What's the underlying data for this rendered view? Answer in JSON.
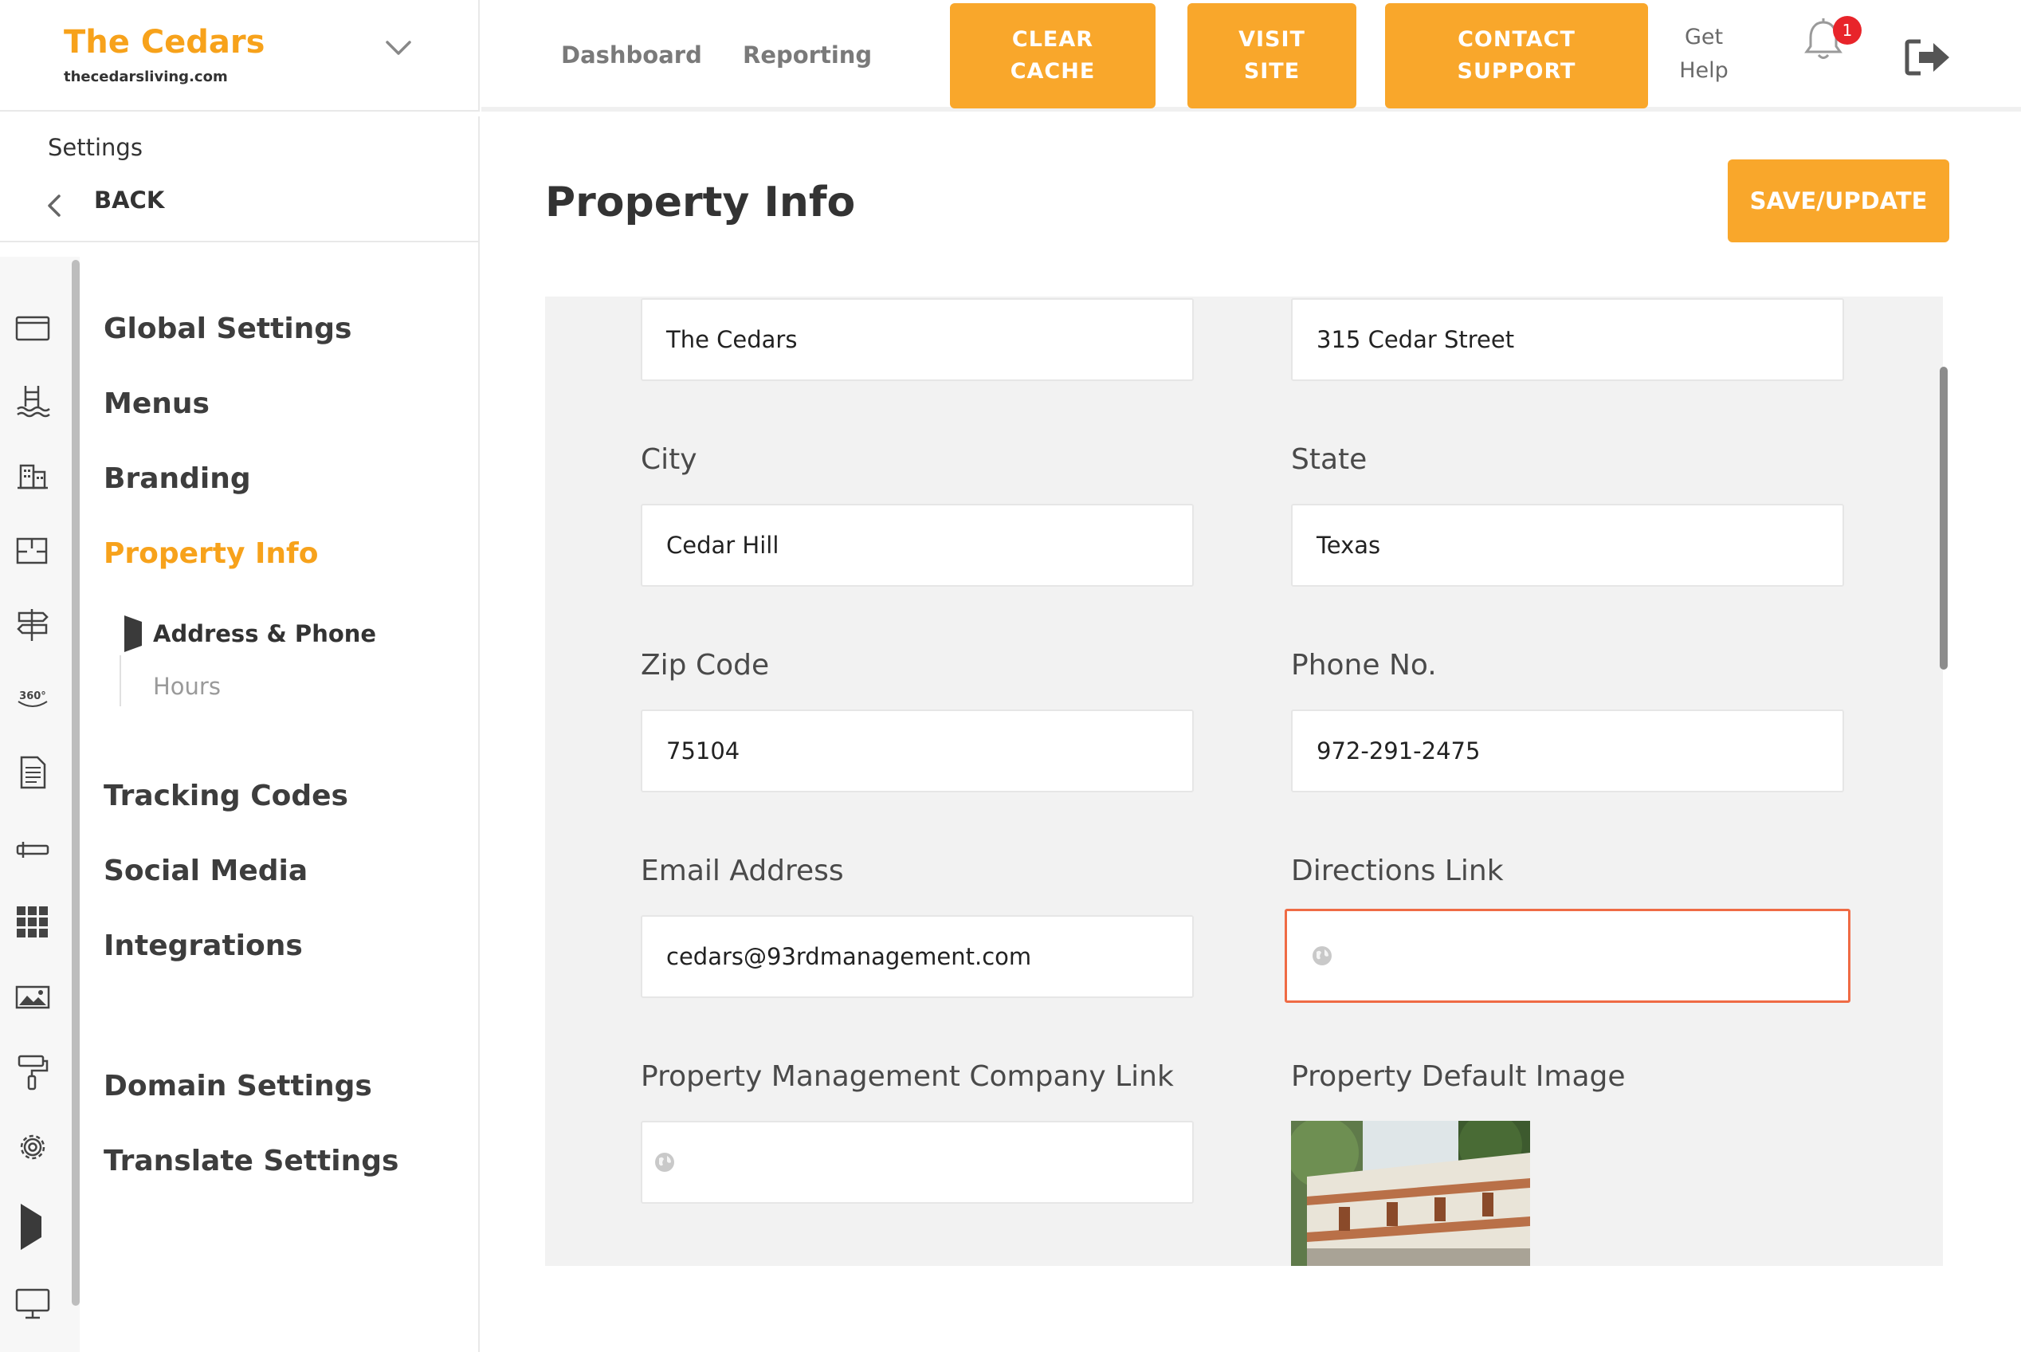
{
  "brand": {
    "name": "The Cedars",
    "domain": "thecedarsliving.com"
  },
  "topnav": {
    "dashboard": "Dashboard",
    "reporting": "Reporting",
    "clear_cache": [
      "CLEAR",
      "CACHE"
    ],
    "visit_site": [
      "VISIT",
      "SITE"
    ],
    "contact_support": [
      "CONTACT",
      "SUPPORT"
    ],
    "get_help": [
      "Get",
      "Help"
    ],
    "notification_count": "1"
  },
  "colors": {
    "accent": "#f9a72b",
    "active_text": "#f7a21b",
    "badge": "#e8242a",
    "focus_border": "#ef6b45"
  },
  "sidebar": {
    "header": "Settings",
    "back": "BACK",
    "items": {
      "global": "Global Settings",
      "menus": "Menus",
      "branding": "Branding",
      "property": "Property Info",
      "tracking": "Tracking Codes",
      "social": "Social Media",
      "integrations": "Integrations",
      "domain": "Domain Settings",
      "translate": "Translate Settings"
    },
    "subitems": {
      "address": "Address & Phone",
      "hours": "Hours"
    },
    "rail_icons": [
      "browser-window-icon",
      "pool-icon",
      "buildings-icon",
      "floorplan-icon",
      "signpost-icon",
      "360-view-icon",
      "document-icon",
      "key-icon",
      "grid-apps-icon",
      "image-icon",
      "paint-roller-icon",
      "gear-icon",
      "play-marker-icon",
      "monitor-icon"
    ]
  },
  "main": {
    "title": "Property Info",
    "save": "SAVE/UPDATE",
    "fields": {
      "property_name": "The Cedars",
      "street": "315 Cedar Street",
      "city_label": "City",
      "city": "Cedar Hill",
      "state_label": "State",
      "state": "Texas",
      "zip_label": "Zip Code",
      "zip": "75104",
      "phone_label": "Phone No.",
      "phone": "972-291-2475",
      "email_label": "Email Address",
      "email": "cedars@93rdmanagement.com",
      "directions_label": "Directions Link",
      "directions": "",
      "pm_link_label": "Property Management Company Link",
      "pm_link": "",
      "default_image_label": "Property Default Image"
    }
  }
}
